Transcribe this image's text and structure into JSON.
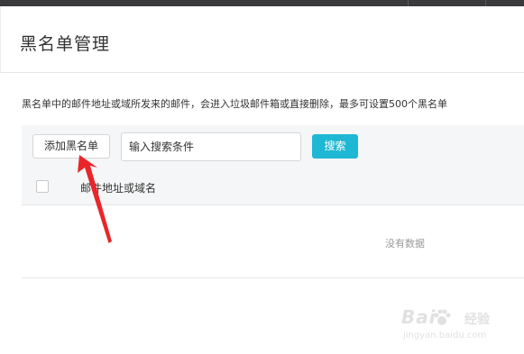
{
  "header": {
    "title": "黑名单管理"
  },
  "description": "黑名单中的邮件地址或域所发来的邮件，会进入垃圾邮件箱或直接删除，最多可设置500个黑名单",
  "toolbar": {
    "add_label": "添加黑名单",
    "search_placeholder": "输入搜索条件",
    "search_label": "搜索"
  },
  "table": {
    "columns": [
      "邮件地址或域名"
    ],
    "rows": [],
    "empty_text": "没有数据"
  },
  "watermark": {
    "brand": "Bai",
    "brand_suffix": "经验",
    "url": "jingyan.baidu.com"
  },
  "colors": {
    "accent": "#1eb8d4",
    "annotation_arrow": "#e8262a"
  }
}
